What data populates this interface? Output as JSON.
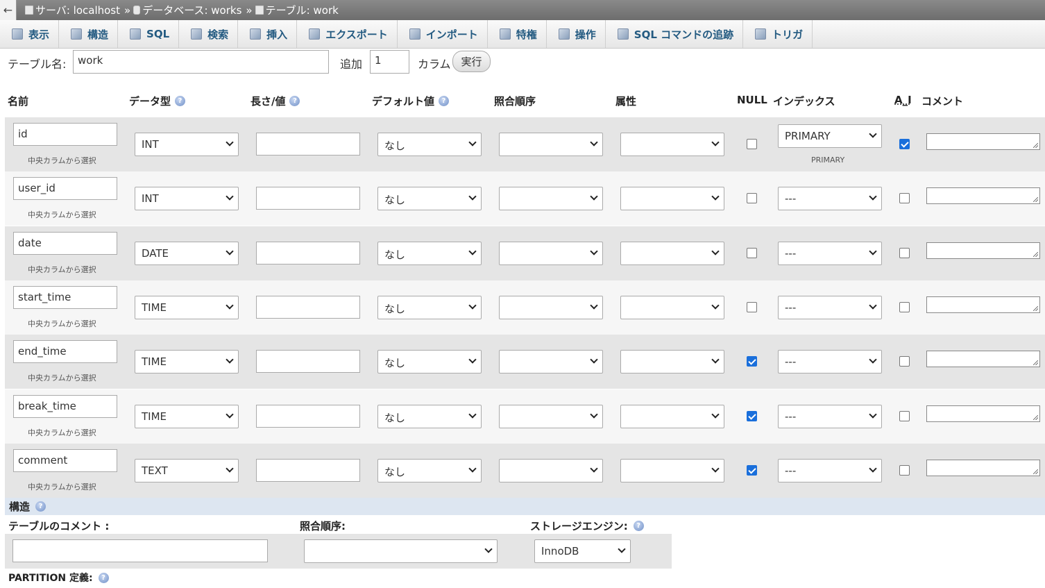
{
  "breadcrumb": [
    {
      "label": "サーバ: localhost"
    },
    {
      "label": "データベース: works"
    },
    {
      "label": "テーブル: work"
    }
  ],
  "breadcrumb_sep": "»",
  "back_glyph": "←",
  "tabs": [
    {
      "label": "表示",
      "icon": "browse-icon"
    },
    {
      "label": "構造",
      "icon": "structure-icon"
    },
    {
      "label": "SQL",
      "icon": "sql-icon"
    },
    {
      "label": "検索",
      "icon": "search-icon"
    },
    {
      "label": "挿入",
      "icon": "insert-icon"
    },
    {
      "label": "エクスポート",
      "icon": "export-icon"
    },
    {
      "label": "インポート",
      "icon": "import-icon"
    },
    {
      "label": "特権",
      "icon": "privileges-icon"
    },
    {
      "label": "操作",
      "icon": "wrench-icon"
    },
    {
      "label": "SQL コマンドの追跡",
      "icon": "eye-icon"
    },
    {
      "label": "トリガ",
      "icon": "triggers-icon"
    }
  ],
  "table_name": {
    "label": "テーブル名:",
    "value": "work"
  },
  "add": {
    "label": "追加",
    "value": "1",
    "suffix": "カラム",
    "button": "実行"
  },
  "headers": {
    "name": "名前",
    "type": "データ型",
    "length": "長さ/値",
    "default": "デフォルト値",
    "collation": "照合順序",
    "attributes": "属性",
    "null": "NULL",
    "index": "インデックス",
    "ai": "A_I",
    "comment": "コメント"
  },
  "central_link": "中央カラムから選択",
  "columns": [
    {
      "name": "id",
      "type": "INT",
      "default": "なし",
      "null": false,
      "index": "PRIMARY",
      "index_note": "PRIMARY",
      "ai": true
    },
    {
      "name": "user_id",
      "type": "INT",
      "default": "なし",
      "null": false,
      "index": "---",
      "index_note": "",
      "ai": false
    },
    {
      "name": "date",
      "type": "DATE",
      "default": "なし",
      "null": false,
      "index": "---",
      "index_note": "",
      "ai": false
    },
    {
      "name": "start_time",
      "type": "TIME",
      "default": "なし",
      "null": false,
      "index": "---",
      "index_note": "",
      "ai": false
    },
    {
      "name": "end_time",
      "type": "TIME",
      "default": "なし",
      "null": true,
      "index": "---",
      "index_note": "",
      "ai": false
    },
    {
      "name": "break_time",
      "type": "TIME",
      "default": "なし",
      "null": true,
      "index": "---",
      "index_note": "",
      "ai": false
    },
    {
      "name": "comment",
      "type": "TEXT",
      "default": "なし",
      "null": true,
      "index": "---",
      "index_note": "",
      "ai": false
    }
  ],
  "structure": {
    "title": "構造",
    "table_comment_label": "テーブルのコメント :",
    "collation_label": "照合順序:",
    "engine_label": "ストレージエンジン:",
    "engine_value": "InnoDB",
    "partition_label": "PARTITION 定義:"
  }
}
